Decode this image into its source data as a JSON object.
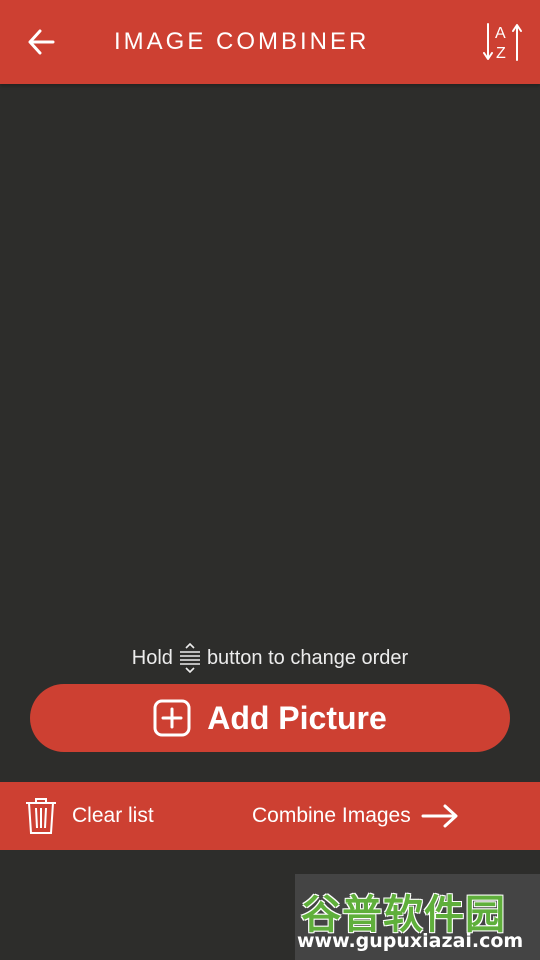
{
  "header": {
    "title": "IMAGE COMBINER",
    "back_icon": "arrow-left-icon",
    "sort_icon": "sort-az-icon",
    "color": "#cd4032"
  },
  "hint": {
    "before": "Hold",
    "after": "button to change order",
    "icon": "drag-handle-icon"
  },
  "add_button": {
    "label": "Add Picture",
    "icon": "plus-square-icon"
  },
  "bottom_bar": {
    "clear_label": "Clear list",
    "clear_icon": "trash-icon",
    "combine_label": "Combine Images",
    "combine_icon": "arrow-right-icon"
  },
  "watermark": {
    "logo": "谷普软件园",
    "url": "www.gupuxiazai.com"
  },
  "colors": {
    "accent": "#cd4032",
    "background": "#2d2d2b",
    "text": "#ffffff"
  }
}
